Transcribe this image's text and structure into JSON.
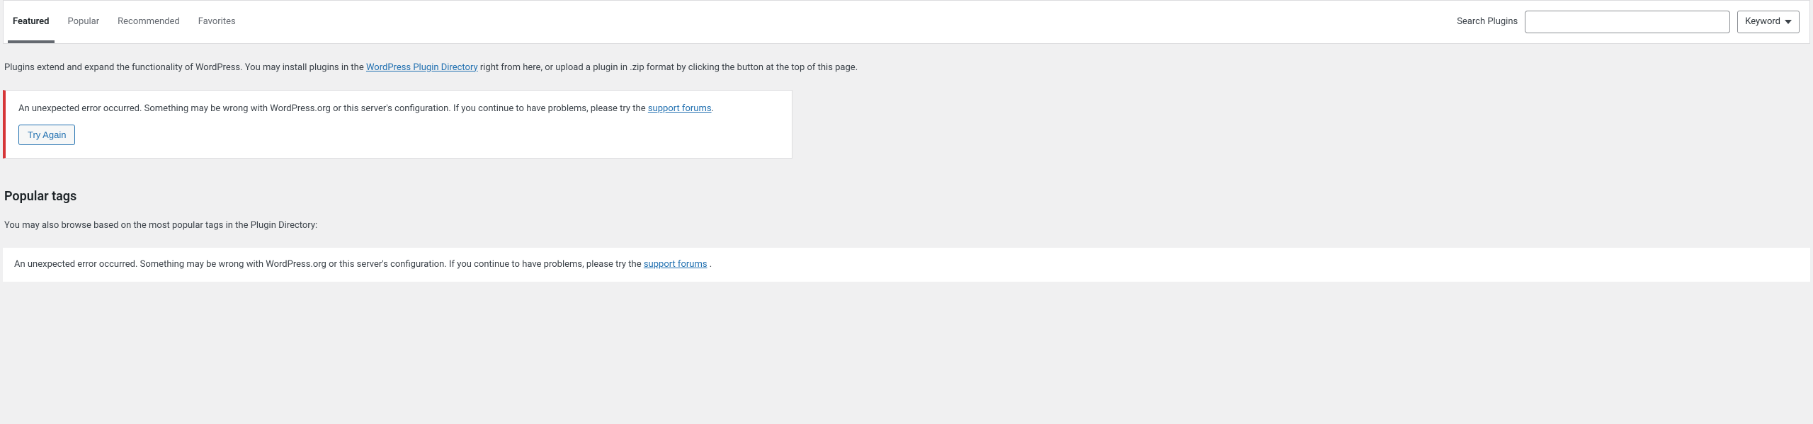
{
  "tabs": {
    "featured": "Featured",
    "popular": "Popular",
    "recommended": "Recommended",
    "favorites": "Favorites"
  },
  "search": {
    "label": "Search Plugins",
    "value": "",
    "keyword": "Keyword"
  },
  "description": {
    "pre": "Plugins extend and expand the functionality of WordPress. You may install plugins in the ",
    "link": "WordPress Plugin Directory",
    "post": " right from here, or upload a plugin in .zip format by clicking the button at the top of this page."
  },
  "notice": {
    "msg_pre": "An unexpected error occurred. Something may be wrong with WordPress.org or this server's configuration. If you continue to have problems, please try the ",
    "link": "support forums",
    "msg_post": ".",
    "button": "Try Again"
  },
  "popular_tags": {
    "heading": "Popular tags",
    "sub": "You may also browse based on the most popular tags in the Plugin Directory:",
    "error_pre": "An unexpected error occurred. Something may be wrong with WordPress.org or this server's configuration. If you continue to have problems, please try the ",
    "error_link": "support forums",
    "error_post": " ."
  }
}
